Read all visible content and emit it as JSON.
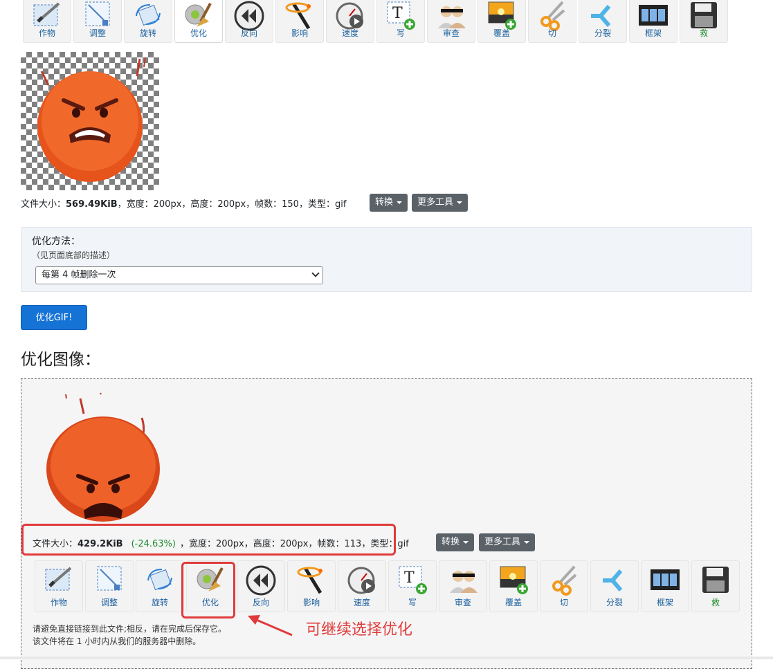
{
  "toolbar_top": {
    "items": [
      {
        "label": "作物",
        "icon": "crop-icon"
      },
      {
        "label": "调整",
        "icon": "resize-icon"
      },
      {
        "label": "旋转",
        "icon": "rotate-icon"
      },
      {
        "label": "优化",
        "icon": "optimize-icon",
        "active": true
      },
      {
        "label": "反向",
        "icon": "reverse-icon"
      },
      {
        "label": "影响",
        "icon": "effects-icon"
      },
      {
        "label": "速度",
        "icon": "speed-icon"
      },
      {
        "label": "写",
        "icon": "write-text-icon"
      },
      {
        "label": "审查",
        "icon": "censor-icon"
      },
      {
        "label": "覆盖",
        "icon": "overlay-icon"
      },
      {
        "label": "切",
        "icon": "cut-icon"
      },
      {
        "label": "分裂",
        "icon": "split-icon"
      },
      {
        "label": "框架",
        "icon": "frames-icon"
      },
      {
        "label": "救",
        "icon": "save-icon"
      }
    ]
  },
  "original": {
    "info_prefix": "文件大小：",
    "size": "569.49KiB",
    "info_rest": "，宽度：200px，高度：200px，帧数：150，类型：gif",
    "convert_label": "转换",
    "more_tools_label": "更多工具"
  },
  "options": {
    "method_label": "优化方法：",
    "method_hint": "（见页面底部的描述）",
    "selected": "每第 4 帧删除一次"
  },
  "optimize_button": "优化GIF!",
  "result": {
    "heading": "优化图像：",
    "info_prefix": "文件大小：",
    "size": "429.2KiB",
    "change": "(-24.63%)",
    "info_rest": "，宽度：200px，高度：200px，帧数：113，类型：gif",
    "convert_label": "转换",
    "more_tools_label": "更多工具",
    "note_line1": "请避免直接链接到此文件;相反，请在完成后保存它。",
    "note_line2": "该文件将在 1 小时内从我们的服务器中删除。"
  },
  "annotation": {
    "text": "可继续选择优化",
    "color": "#e03a3a"
  },
  "colors": {
    "primary": "#1673d6",
    "link": "#1a5f9e",
    "success": "#1c8c2a",
    "highlight": "#e03a3a"
  }
}
